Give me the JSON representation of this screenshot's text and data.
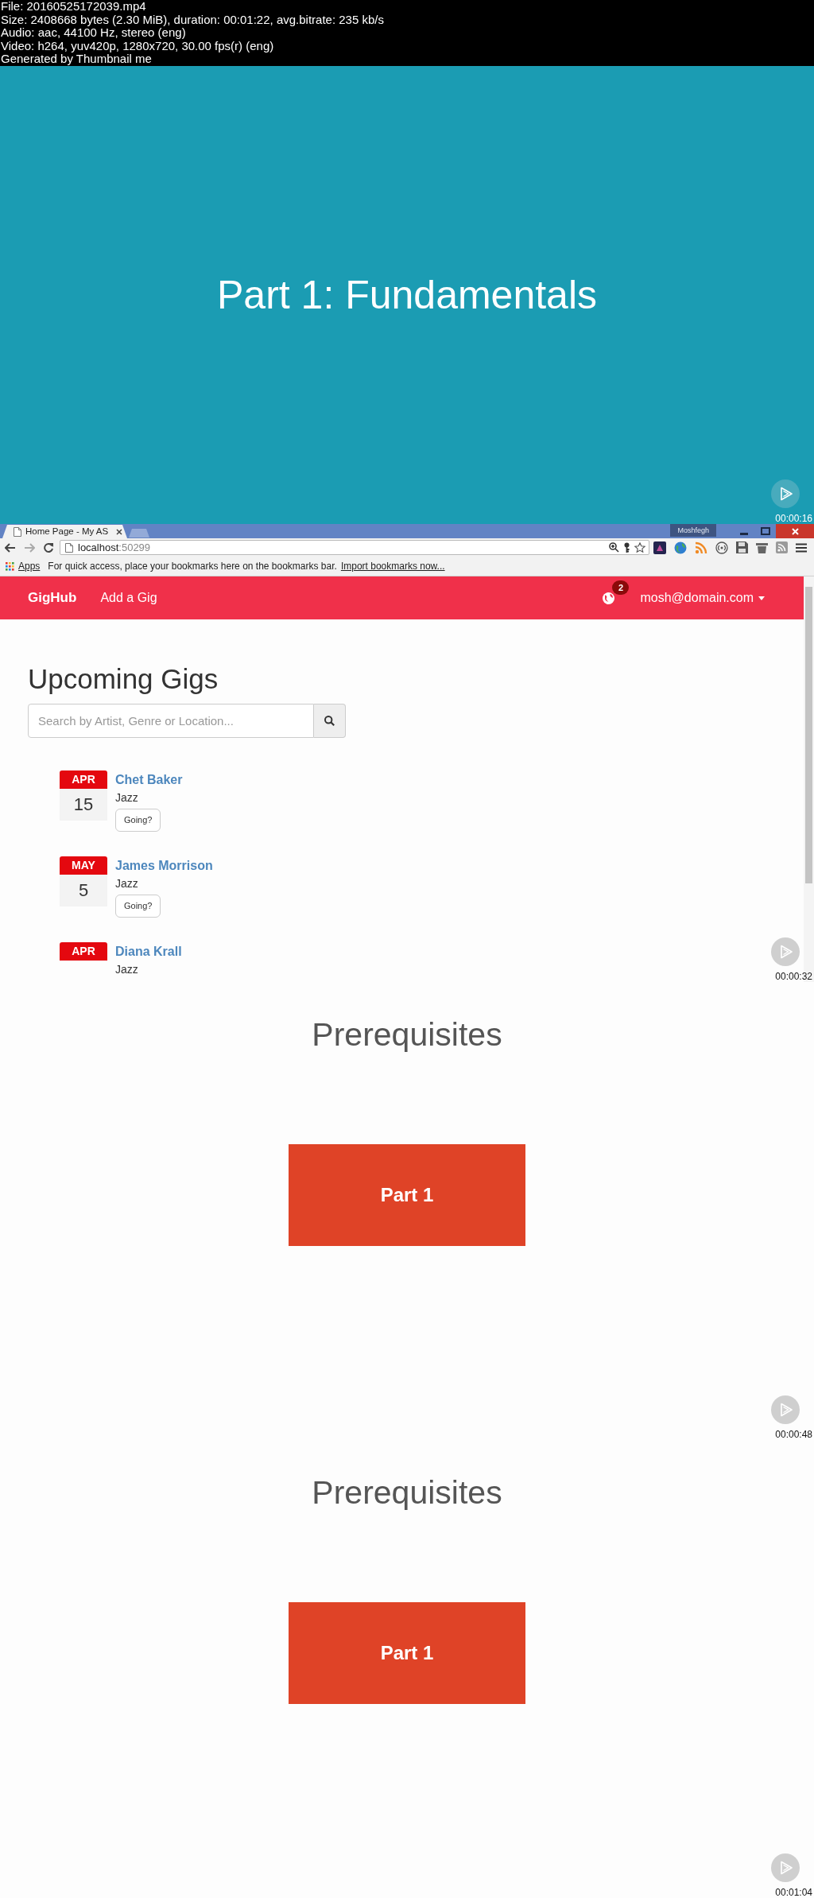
{
  "file_info": {
    "lines": [
      "File: 20160525172039.mp4",
      "Size: 2408668 bytes (2.30 MiB), duration: 00:01:22, avg.bitrate: 235 kb/s",
      "Audio: aac, 44100 Hz, stereo (eng)",
      "Video: h264, yuv420p, 1280x720, 30.00 fps(r) (eng)",
      "Generated by Thumbnail me"
    ]
  },
  "frames": [
    {
      "kind": "title",
      "title": "Part 1: Fundamentals",
      "timestamp": "00:00:16"
    },
    {
      "kind": "browser",
      "timestamp": "00:00:32",
      "browser": {
        "tab_title": "Home Page - My AS",
        "profile": "Moshfegh",
        "url": {
          "host": "localhost",
          "port": ":50299"
        },
        "bookmarks": {
          "apps_label": "Apps",
          "message": "For quick access, place your bookmarks here on the bookmarks bar.",
          "import_link": "Import bookmarks now..."
        }
      },
      "app": {
        "brand": "GigHub",
        "nav_links": [
          {
            "label": "Add a Gig"
          }
        ],
        "notifications": {
          "count": "2"
        },
        "user": {
          "label": "mosh@domain.com"
        },
        "heading": "Upcoming Gigs",
        "search": {
          "placeholder": "Search by Artist, Genre or Location..."
        },
        "gigs": [
          {
            "month": "APR",
            "day": "15",
            "artist": "Chet Baker",
            "genre": "Jazz",
            "action": "Going?"
          },
          {
            "month": "MAY",
            "day": "5",
            "artist": "James Morrison",
            "genre": "Jazz",
            "action": "Going?"
          },
          {
            "month": "APR",
            "artist": "Diana Krall",
            "genre": "Jazz"
          }
        ]
      }
    },
    {
      "kind": "section",
      "title": "Prerequisites",
      "card": "Part 1",
      "timestamp": "00:00:48"
    },
    {
      "kind": "section",
      "title": "Prerequisites",
      "card": "Part 1",
      "timestamp": "00:01:04"
    }
  ]
}
